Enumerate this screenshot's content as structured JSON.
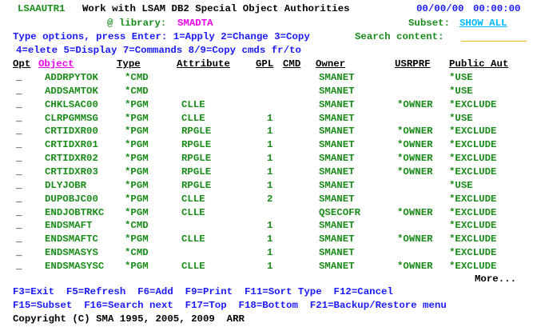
{
  "header": {
    "program": "LSAAUTR1",
    "title": "Work with LSAM DB2 Special Object Authorities",
    "date": "00/00/00",
    "time": "00:00:00",
    "library_label": "@ library:",
    "library_value": "SMADTA",
    "subset_label": "Subset:",
    "subset_value": "SHOW ALL"
  },
  "instructions": {
    "line1": "Type options, press Enter: 1=Apply 2=Change 3=Copy",
    "search_label": "Search content:",
    "line2": "4=elete 5=Display 7=Commands 8/9=Copy cmds fr/to"
  },
  "columns": {
    "opt": "Opt",
    "object": "Object",
    "type": "Type",
    "attribute": "Attribute",
    "gpl": "GPL",
    "cmd": "CMD",
    "owner": "Owner",
    "usrprf": "USRPRF",
    "public_aut": "Public Aut"
  },
  "rows": [
    {
      "opt": "_",
      "object": "ADDRPYTOK",
      "type": "*CMD",
      "attribute": "",
      "gpl": "",
      "cmd": "",
      "owner": "SMANET",
      "usrprf": "",
      "public_aut": "*USE"
    },
    {
      "opt": "_",
      "object": "ADDSAMTOK",
      "type": "*CMD",
      "attribute": "",
      "gpl": "",
      "cmd": "",
      "owner": "SMANET",
      "usrprf": "",
      "public_aut": "*USE"
    },
    {
      "opt": "_",
      "object": "CHKLSAC00",
      "type": "*PGM",
      "attribute": "CLLE",
      "gpl": "",
      "cmd": "",
      "owner": "SMANET",
      "usrprf": "*OWNER",
      "public_aut": "*EXCLUDE"
    },
    {
      "opt": "_",
      "object": "CLRPGMMSG",
      "type": "*PGM",
      "attribute": "CLLE",
      "gpl": "1",
      "cmd": "",
      "owner": "SMANET",
      "usrprf": "",
      "public_aut": "*USE"
    },
    {
      "opt": "_",
      "object": "CRTIDXR00",
      "type": "*PGM",
      "attribute": "RPGLE",
      "gpl": "1",
      "cmd": "",
      "owner": "SMANET",
      "usrprf": "*OWNER",
      "public_aut": "*EXCLUDE"
    },
    {
      "opt": "_",
      "object": "CRTIDXR01",
      "type": "*PGM",
      "attribute": "RPGLE",
      "gpl": "1",
      "cmd": "",
      "owner": "SMANET",
      "usrprf": "*OWNER",
      "public_aut": "*EXCLUDE"
    },
    {
      "opt": "_",
      "object": "CRTIDXR02",
      "type": "*PGM",
      "attribute": "RPGLE",
      "gpl": "1",
      "cmd": "",
      "owner": "SMANET",
      "usrprf": "*OWNER",
      "public_aut": "*EXCLUDE"
    },
    {
      "opt": "_",
      "object": "CRTIDXR03",
      "type": "*PGM",
      "attribute": "RPGLE",
      "gpl": "1",
      "cmd": "",
      "owner": "SMANET",
      "usrprf": "*OWNER",
      "public_aut": "*EXCLUDE"
    },
    {
      "opt": "_",
      "object": "DLYJOBR",
      "type": "*PGM",
      "attribute": "RPGLE",
      "gpl": "1",
      "cmd": "",
      "owner": "SMANET",
      "usrprf": "",
      "public_aut": "*USE"
    },
    {
      "opt": "_",
      "object": "DUPOBJC00",
      "type": "*PGM",
      "attribute": "CLLE",
      "gpl": "2",
      "cmd": "",
      "owner": "SMANET",
      "usrprf": "",
      "public_aut": "*EXCLUDE"
    },
    {
      "opt": "_",
      "object": "ENDJOBTRKC",
      "type": "*PGM",
      "attribute": "CLLE",
      "gpl": "",
      "cmd": "",
      "owner": "QSECOFR",
      "usrprf": "*OWNER",
      "public_aut": "*EXCLUDE"
    },
    {
      "opt": "_",
      "object": "ENDSMAFT",
      "type": "*CMD",
      "attribute": "",
      "gpl": "1",
      "cmd": "",
      "owner": "SMANET",
      "usrprf": "",
      "public_aut": "*EXCLUDE"
    },
    {
      "opt": "_",
      "object": "ENDSMAFTC",
      "type": "*PGM",
      "attribute": "CLLE",
      "gpl": "1",
      "cmd": "",
      "owner": "SMANET",
      "usrprf": "*OWNER",
      "public_aut": "*EXCLUDE"
    },
    {
      "opt": "_",
      "object": "ENDSMASYS",
      "type": "*CMD",
      "attribute": "",
      "gpl": "1",
      "cmd": "",
      "owner": "SMANET",
      "usrprf": "",
      "public_aut": "*EXCLUDE"
    },
    {
      "opt": "_",
      "object": "ENDSMASYSC",
      "type": "*PGM",
      "attribute": "CLLE",
      "gpl": "1",
      "cmd": "",
      "owner": "SMANET",
      "usrprf": "*OWNER",
      "public_aut": "*EXCLUDE"
    }
  ],
  "more": "More...",
  "fkeys": {
    "line1": "F3=Exit  F5=Refresh  F6=Add  F9=Print  F11=Sort Type  F12=Cancel",
    "line2": "F15=Subset  F16=Search next  F17=Top  F18=Bottom  F21=Backup/Restore menu"
  },
  "copyright": "Copyright (C) SMA 1995, 2005, 2009  ARR",
  "colors": {
    "green": "#1a8c1a",
    "blue": "#1a1aff",
    "pink": "#ee00ee",
    "cyan": "#00b8ff",
    "input_underline": "#f0b800"
  }
}
